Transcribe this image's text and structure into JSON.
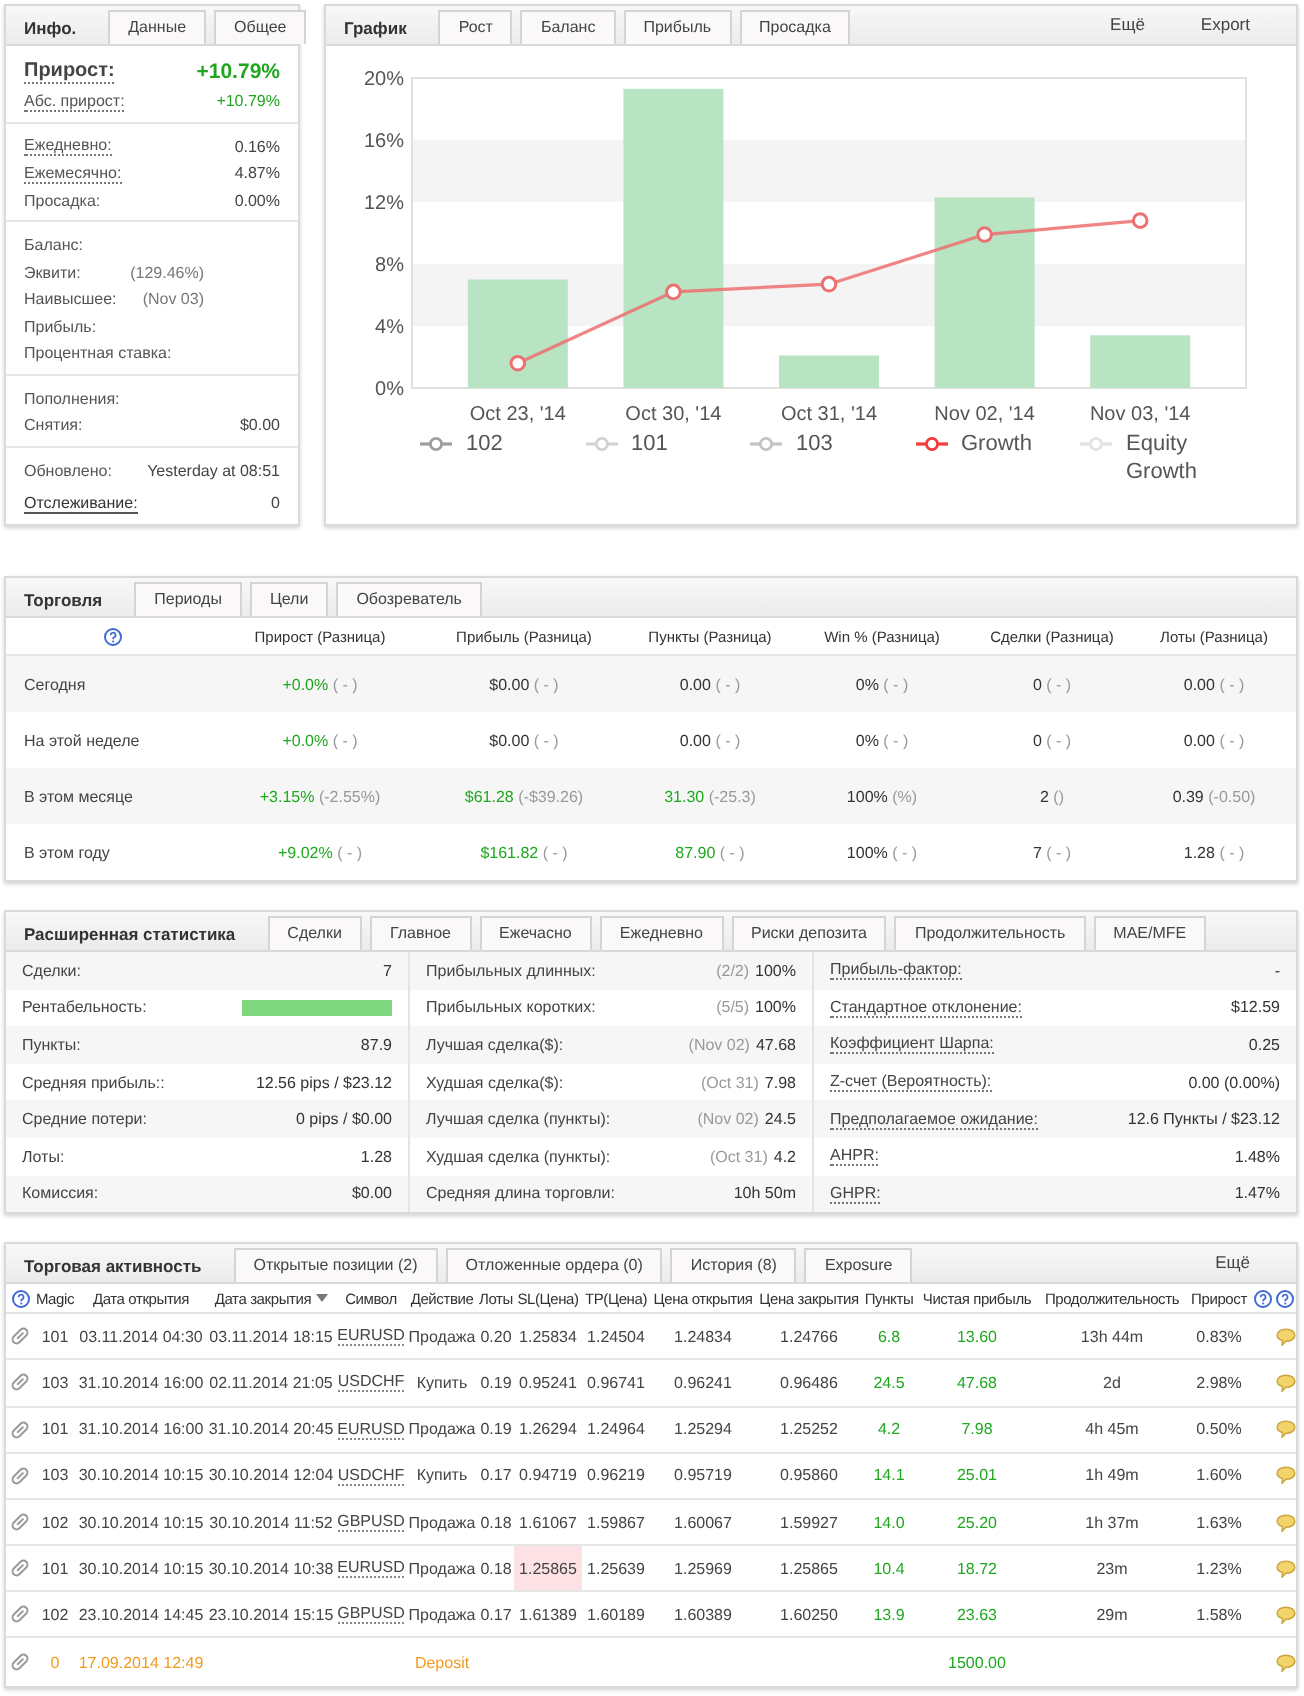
{
  "info": {
    "tabs": [
      {
        "label": "Инфо.",
        "selected": true
      },
      {
        "label": "Данные",
        "selected": false
      },
      {
        "label": "Общее",
        "selected": false
      }
    ],
    "sections": [
      {
        "rows": [
          {
            "kind": "headline",
            "label": "Прирост:",
            "value": "+10.79%",
            "positive": true
          },
          {
            "kind": "tip",
            "label": "Абс. прирост:",
            "value": "+10.79%",
            "positive": true
          }
        ]
      },
      {
        "rows": [
          {
            "kind": "tip",
            "label": "Ежедневно:",
            "value": "0.16%",
            "positive": false
          },
          {
            "kind": "tip",
            "label": "Ежемесячно:",
            "value": "4.87%",
            "positive": false
          },
          {
            "kind": "plain",
            "label": "Просадка:",
            "value": "0.00%",
            "positive": false
          }
        ]
      },
      {
        "rows": [
          {
            "kind": "plain",
            "label": "Баланс:"
          },
          {
            "kind": "plain",
            "label": "Эквити:",
            "note": "(129.46%)"
          },
          {
            "kind": "plain",
            "label": "Наивысшее:",
            "note": "(Nov 03)"
          },
          {
            "kind": "plain",
            "label": "Прибыль:"
          },
          {
            "kind": "plain",
            "label": "Процентная ставка:"
          }
        ]
      },
      {
        "rows": [
          {
            "kind": "plain",
            "label": "Пополнения:"
          },
          {
            "kind": "plain",
            "label": "Снятия:",
            "value": "$0.00",
            "positive": false
          }
        ]
      },
      {
        "rows": [
          {
            "kind": "plain",
            "label": "Обновлено:",
            "value": "Yesterday at 08:51",
            "positive": false
          },
          {
            "kind": "link",
            "label": "Отслеживание:",
            "value": "0",
            "positive": false
          }
        ]
      }
    ]
  },
  "chart": {
    "tabs": [
      {
        "label": "График",
        "selected": true
      },
      {
        "label": "Рост",
        "selected": false
      },
      {
        "label": "Баланс",
        "selected": false
      },
      {
        "label": "Прибыль",
        "selected": false
      },
      {
        "label": "Просадка",
        "selected": false
      }
    ],
    "actions": [
      "Ещё",
      "Export"
    ],
    "chart_data": {
      "type": "bar",
      "categories": [
        "Oct 23, '14",
        "Oct 30, '14",
        "Oct 31, '14",
        "Nov 02, '14",
        "Nov 03, '14"
      ],
      "ylim": [
        0,
        20
      ],
      "yticks": [
        {
          "value": 0,
          "label": "0%"
        },
        {
          "value": 4,
          "label": "4%"
        },
        {
          "value": 8,
          "label": "8%"
        },
        {
          "value": 12,
          "label": "12%"
        },
        {
          "value": 16,
          "label": "16%"
        },
        {
          "value": 20,
          "label": "20%"
        }
      ],
      "series": [
        {
          "color": "#b9e4c3",
          "values": [
            7.0,
            19.3,
            2.1,
            12.3,
            3.4
          ]
        },
        {
          "type": "line",
          "marker": "circle",
          "color": "#ec7070",
          "values": [
            1.6,
            6.2,
            6.7,
            9.9,
            10.8
          ]
        }
      ]
    },
    "legend": [
      {
        "label": "102",
        "color": "#9e9e9e"
      },
      {
        "label": "101",
        "color": "#d2d2d2"
      },
      {
        "label": "103",
        "color": "#c4c4c4"
      },
      {
        "label": "Growth",
        "color": "#f03c3c"
      },
      {
        "label": "Equity Growth",
        "color": "#e2e2e2"
      }
    ]
  },
  "trading": {
    "tabs": [
      {
        "label": "Торговля",
        "selected": true
      },
      {
        "label": "Периоды",
        "selected": false
      },
      {
        "label": "Цели",
        "selected": false
      },
      {
        "label": "Обозреватель",
        "selected": false
      }
    ],
    "columns": [
      "Прирост (Разница)",
      "Прибыль (Разница)",
      "Пункты (Разница)",
      "Win % (Разница)",
      "Сделки (Разница)",
      "Лоты (Разница)"
    ],
    "rows": [
      {
        "label": "Сегодня",
        "cells": [
          {
            "value": "+0.0%",
            "diff": "( - )",
            "positive": true
          },
          {
            "value": "$0.00",
            "diff": "( - )",
            "positive": false
          },
          {
            "value": "0.00",
            "diff": "( - )",
            "positive": false
          },
          {
            "value": "0%",
            "diff": "( - )",
            "positive": false
          },
          {
            "value": "0",
            "diff": "( - )",
            "positive": false
          },
          {
            "value": "0.00",
            "diff": "( - )",
            "positive": false
          }
        ]
      },
      {
        "label": "На этой неделе",
        "cells": [
          {
            "value": "+0.0%",
            "diff": "( - )",
            "positive": true
          },
          {
            "value": "$0.00",
            "diff": "( - )",
            "positive": false
          },
          {
            "value": "0.00",
            "diff": "( - )",
            "positive": false
          },
          {
            "value": "0%",
            "diff": "( - )",
            "positive": false
          },
          {
            "value": "0",
            "diff": "( - )",
            "positive": false
          },
          {
            "value": "0.00",
            "diff": "( - )",
            "positive": false
          }
        ]
      },
      {
        "label": "В этом месяце",
        "cells": [
          {
            "value": "+3.15%",
            "diff": "(-2.55%)",
            "positive": true
          },
          {
            "value": "$61.28",
            "diff": "(-$39.26)",
            "positive": true
          },
          {
            "value": "31.30",
            "diff": "(-25.3)",
            "positive": true
          },
          {
            "value": "100%",
            "diff": "(%)",
            "positive": false
          },
          {
            "value": "2",
            "diff": "()",
            "positive": false
          },
          {
            "value": "0.39",
            "diff": "(-0.50)",
            "positive": false
          }
        ]
      },
      {
        "label": "В этом году",
        "cells": [
          {
            "value": "+9.02%",
            "diff": "( - )",
            "positive": true
          },
          {
            "value": "$161.82",
            "diff": "( - )",
            "positive": true
          },
          {
            "value": "87.90",
            "diff": "( - )",
            "positive": true
          },
          {
            "value": "100%",
            "diff": "( - )",
            "positive": false
          },
          {
            "value": "7",
            "diff": "( - )",
            "positive": false
          },
          {
            "value": "1.28",
            "diff": "( - )",
            "positive": false
          }
        ]
      }
    ]
  },
  "extended": {
    "tabs": [
      {
        "label": "Расширенная статистика",
        "selected": true
      },
      {
        "label": "Сделки",
        "selected": false
      },
      {
        "label": "Главное",
        "selected": false
      },
      {
        "label": "Ежечасно",
        "selected": false
      },
      {
        "label": "Ежедневно",
        "selected": false
      },
      {
        "label": "Риски депозита",
        "selected": false
      },
      {
        "label": "Продолжительность",
        "selected": false
      },
      {
        "label": "MAE/MFE",
        "selected": false
      }
    ],
    "columns": [
      {
        "rows": [
          {
            "kind": "text",
            "label": "Сделки:",
            "value": "7",
            "tip": false
          },
          {
            "kind": "bar",
            "label": "Рентабельность:",
            "level": 1,
            "tip": false
          },
          {
            "kind": "text",
            "label": "Пункты:",
            "value": "87.9",
            "tip": false
          },
          {
            "kind": "text",
            "label": "Средняя прибыль::",
            "value": "12.56 pips / $23.12",
            "tip": false
          },
          {
            "kind": "text",
            "label": "Средние потери:",
            "value": "0 pips / $0.00",
            "tip": false
          },
          {
            "kind": "text",
            "label": "Лоты:",
            "value": "1.28",
            "tip": false
          },
          {
            "kind": "text",
            "label": "Комиссия:",
            "value": "$0.00",
            "tip": false
          }
        ]
      },
      {
        "rows": [
          {
            "kind": "text",
            "label": "Прибыльных длинных:",
            "note": "(2/2)",
            "value": "100%",
            "tip": false
          },
          {
            "kind": "text",
            "label": "Прибыльных коротких:",
            "note": "(5/5)",
            "value": "100%",
            "tip": false
          },
          {
            "kind": "text",
            "label": "Лучшая сделка($):",
            "note": "(Nov 02)",
            "value": "47.68",
            "tip": false
          },
          {
            "kind": "text",
            "label": "Худшая сделка($):",
            "note": "(Oct 31)",
            "value": "7.98",
            "tip": false
          },
          {
            "kind": "text",
            "label": "Лучшая сделка (пункты):",
            "note": "(Nov 02)",
            "value": "24.5",
            "tip": false
          },
          {
            "kind": "text",
            "label": "Худшая сделка (пункты):",
            "note": "(Oct 31)",
            "value": "4.2",
            "tip": false
          },
          {
            "kind": "text",
            "label": "Средняя длина торговли:",
            "value": "10h 50m",
            "tip": false
          }
        ]
      },
      {
        "rows": [
          {
            "kind": "text",
            "label": "Прибыль-фактор:",
            "value": "-",
            "tip": true
          },
          {
            "kind": "text",
            "label": "Стандартное отклонение:",
            "value": "$12.59",
            "tip": true
          },
          {
            "kind": "text",
            "label": "Коэффициент Шарпа:",
            "value": "0.25",
            "tip": true
          },
          {
            "kind": "text",
            "label": "Z-счет (Вероятность):",
            "value": "0.00 (0.00%)",
            "tip": true
          },
          {
            "kind": "text",
            "label": "Предполагаемое ожидание:",
            "value": "12.6 Пункты / $23.12",
            "tip": true
          },
          {
            "kind": "text",
            "label": "AHPR:",
            "value": "1.48%",
            "tip": true
          },
          {
            "kind": "text",
            "label": "GHPR:",
            "value": "1.47%",
            "tip": true
          }
        ]
      }
    ]
  },
  "activity": {
    "tabs": [
      {
        "label": "Торговая активность",
        "selected": true
      },
      {
        "label": "Открытые позиции (2)",
        "selected": false
      },
      {
        "label": "Отложенные ордера (0)",
        "selected": false
      },
      {
        "label": "История (8)",
        "selected": false
      },
      {
        "label": "Exposure",
        "selected": false
      }
    ],
    "actions": [
      "Ещё"
    ],
    "columns": [
      {
        "label": "Magic",
        "sorted": false
      },
      {
        "label": "Дата открытия",
        "sorted": false
      },
      {
        "label": "Дата закрытия",
        "sorted": true
      },
      {
        "label": "Символ",
        "sorted": false
      },
      {
        "label": "Действие",
        "sorted": false
      },
      {
        "label": "Лоты",
        "sorted": false
      },
      {
        "label": "SL(Цена)",
        "sorted": false
      },
      {
        "label": "TP(Цена)",
        "sorted": false
      },
      {
        "label": "Цена открытия",
        "sorted": false
      },
      {
        "label": "Цена закрытия",
        "sorted": false
      },
      {
        "label": "Пункты",
        "sorted": false
      },
      {
        "label": "Чистая прибыль",
        "sorted": false
      },
      {
        "label": "Продолжительность",
        "sorted": false
      },
      {
        "label": "Прирост",
        "sorted": false
      }
    ],
    "rows": [
      {
        "kind": "trade",
        "magic": "101",
        "open_time": "03.11.2014 04:30",
        "close_time": "03.11.2014 18:15",
        "symbol": "EURUSD",
        "action": "Продажа",
        "lots": "0.20",
        "sl": "1.25834",
        "tp": "1.24504",
        "open_price": "1.24834",
        "close_price": "1.24766",
        "pips": "6.8",
        "profit": "13.60",
        "duration": "13h 44m",
        "gain": "0.83%",
        "sl_hit": false
      },
      {
        "kind": "trade",
        "magic": "103",
        "open_time": "31.10.2014 16:00",
        "close_time": "02.11.2014 21:05",
        "symbol": "USDCHF",
        "action": "Купить",
        "lots": "0.19",
        "sl": "0.95241",
        "tp": "0.96741",
        "open_price": "0.96241",
        "close_price": "0.96486",
        "pips": "24.5",
        "profit": "47.68",
        "duration": "2d",
        "gain": "2.98%",
        "sl_hit": false
      },
      {
        "kind": "trade",
        "magic": "101",
        "open_time": "31.10.2014 16:00",
        "close_time": "31.10.2014 20:45",
        "symbol": "EURUSD",
        "action": "Продажа",
        "lots": "0.19",
        "sl": "1.26294",
        "tp": "1.24964",
        "open_price": "1.25294",
        "close_price": "1.25252",
        "pips": "4.2",
        "profit": "7.98",
        "duration": "4h 45m",
        "gain": "0.50%",
        "sl_hit": false
      },
      {
        "kind": "trade",
        "magic": "103",
        "open_time": "30.10.2014 10:15",
        "close_time": "30.10.2014 12:04",
        "symbol": "USDCHF",
        "action": "Купить",
        "lots": "0.17",
        "sl": "0.94719",
        "tp": "0.96219",
        "open_price": "0.95719",
        "close_price": "0.95860",
        "pips": "14.1",
        "profit": "25.01",
        "duration": "1h 49m",
        "gain": "1.60%",
        "sl_hit": false
      },
      {
        "kind": "trade",
        "magic": "102",
        "open_time": "30.10.2014 10:15",
        "close_time": "30.10.2014 11:52",
        "symbol": "GBPUSD",
        "action": "Продажа",
        "lots": "0.18",
        "sl": "1.61067",
        "tp": "1.59867",
        "open_price": "1.60067",
        "close_price": "1.59927",
        "pips": "14.0",
        "profit": "25.20",
        "duration": "1h 37m",
        "gain": "1.63%",
        "sl_hit": false
      },
      {
        "kind": "trade",
        "magic": "101",
        "open_time": "30.10.2014 10:15",
        "close_time": "30.10.2014 10:38",
        "symbol": "EURUSD",
        "action": "Продажа",
        "lots": "0.18",
        "sl": "1.25865",
        "tp": "1.25639",
        "open_price": "1.25969",
        "close_price": "1.25865",
        "pips": "10.4",
        "profit": "18.72",
        "duration": "23m",
        "gain": "1.23%",
        "sl_hit": true
      },
      {
        "kind": "trade",
        "magic": "102",
        "open_time": "23.10.2014 14:45",
        "close_time": "23.10.2014 15:15",
        "symbol": "GBPUSD",
        "action": "Продажа",
        "lots": "0.17",
        "sl": "1.61389",
        "tp": "1.60189",
        "open_price": "1.60389",
        "close_price": "1.60250",
        "pips": "13.9",
        "profit": "23.63",
        "duration": "29m",
        "gain": "1.58%",
        "sl_hit": false
      },
      {
        "kind": "deposit",
        "magic": "0",
        "open_time": "17.09.2014 12:49",
        "action": "Deposit",
        "profit": "1500.00"
      }
    ]
  }
}
